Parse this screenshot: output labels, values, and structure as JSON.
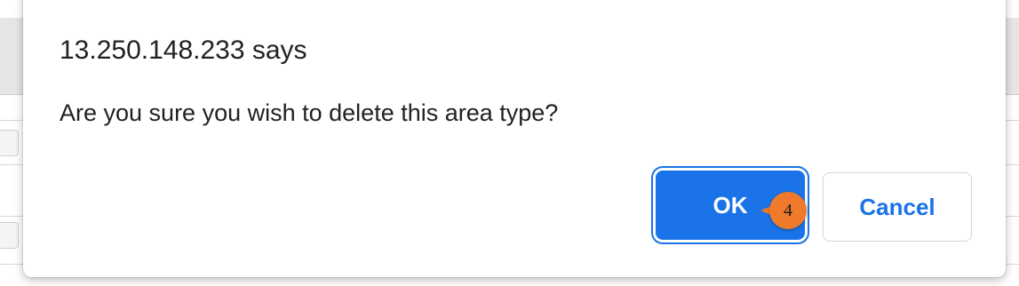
{
  "dialog": {
    "title": "13.250.148.233 says",
    "message": "Are you sure you wish to delete this area type?",
    "ok_label": "OK",
    "cancel_label": "Cancel"
  },
  "annotation": {
    "step_number": "4"
  },
  "colors": {
    "accent": "#1a73e8",
    "marker": "#f07a2b",
    "text": "#202124"
  }
}
